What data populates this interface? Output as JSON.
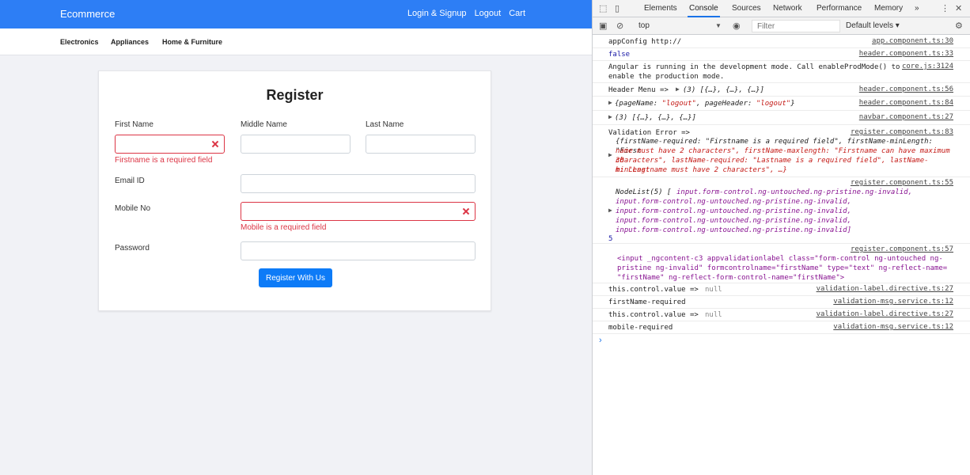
{
  "app": {
    "brand": "Ecommerce",
    "nav": [
      "Login & Signup",
      "Logout",
      "Cart"
    ],
    "categories": [
      "Electronics",
      "Appliances",
      "Home & Furniture"
    ],
    "form": {
      "title": "Register",
      "first_name_label": "First Name",
      "middle_name_label": "Middle Name",
      "last_name_label": "Last Name",
      "first_name_error": "Firstname is a required field",
      "email_label": "Email ID",
      "mobile_label": "Mobile No",
      "mobile_error": "Mobile is a required field",
      "password_label": "Password",
      "submit_label": "Register With Us"
    },
    "colors": {
      "primary": "#2d7ef5",
      "error": "#dc3545"
    }
  },
  "devtools": {
    "tabs": [
      "Elements",
      "Console",
      "Sources",
      "Network",
      "Performance",
      "Memory",
      "»"
    ],
    "context": "top",
    "filter_placeholder": "Filter",
    "levels": "Default levels ▾",
    "logs": {
      "l1": {
        "msg": "appConfig http://",
        "src": "app.component.ts:30"
      },
      "l2": {
        "msg": "false",
        "src": "header.component.ts:33"
      },
      "l3": {
        "msg1": "Angular is running in the development mode. Call enableProdMode() to",
        "msg2": "enable the production mode.",
        "src": "core.js:3124"
      },
      "l4": {
        "msg": "Header Menu =>",
        "obj": "(3) [{…}, {…}, {…}]",
        "src": "header.component.ts:56"
      },
      "l5": {
        "k1": "pageName:",
        "v1": "\"logout\"",
        "k2": "pageHeader:",
        "v2": "\"logout\"",
        "src": "header.component.ts:84"
      },
      "l6": {
        "obj": "(3) [{…}, {…}, {…}]",
        "src": "navbar.component.ts:27"
      },
      "l7": {
        "msg": "Validation Error =>",
        "src": "register.component.ts:83",
        "line1": "{firstName-required: \"Firstname is a required field\", firstName-minLength: \"First",
        "line2": "name must have 2 characters\", firstName-maxlength: \"Firstname can have maximum 30",
        "line3": "characters\", lastName-required: \"Lastname is a required field\", lastName-minLengt",
        "line4": "h: \"Lastname must have 2 characters\", …}"
      },
      "l8": {
        "src": "register.component.ts:55",
        "head": "NodeList(5) [",
        "line1": "input.form-control.ng-untouched.ng-pristine.ng-invalid,",
        "line2": "input.form-control.ng-untouched.ng-pristine.ng-invalid,",
        "line3": "input.form-control.ng-untouched.ng-pristine.ng-invalid,",
        "line4": "input.form-control.ng-untouched.ng-pristine.ng-invalid,",
        "line5": "input.form-control.ng-untouched.ng-pristine.ng-invalid]",
        "count": "5"
      },
      "l9": {
        "src": "register.component.ts:57",
        "line1": "<input _ngcontent-c3 appvalidationlabel class=\"form-control ng-untouched ng-",
        "line2": "pristine ng-invalid\" formcontrolname=\"firstName\" type=\"text\" ng-reflect-name=",
        "line3": "\"firstName\" ng-reflect-form-control-name=\"firstName\">"
      },
      "l10": {
        "msg": "this.control.value =>",
        "val": "null",
        "src": "validation-label.directive.ts:27"
      },
      "l11": {
        "msg": "firstName-required",
        "src": "validation-msg.service.ts:12"
      },
      "l12": {
        "msg": "this.control.value =>",
        "val": "null",
        "src": "validation-label.directive.ts:27"
      },
      "l13": {
        "msg": "mobile-required",
        "src": "validation-msg.service.ts:12"
      }
    }
  }
}
